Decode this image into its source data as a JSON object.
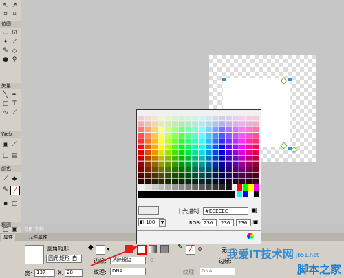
{
  "toolbar": {
    "section_bitmap": "位图",
    "section_vector": "矢量",
    "section_web": "Web",
    "section_colors": "颜色",
    "section_view": "视图",
    "icons": [
      "select-icon",
      "subselect-icon",
      "crop-icon",
      "marquee-icon",
      "lasso-icon",
      "magic-wand-icon",
      "brush-icon",
      "pencil-icon",
      "eraser-icon",
      "blur-icon",
      "line-icon",
      "pen-icon",
      "rectangle-icon",
      "text-icon",
      "freeform-icon",
      "knife-icon",
      "hotspot-icon",
      "slice-icon",
      "hide-slice-icon",
      "show-slice-icon",
      "eyedropper-icon",
      "paint-bucket-icon",
      "stroke-color-icon",
      "fill-color-icon",
      "swap-colors-icon",
      "standard-mode-icon",
      "full-screen-icon",
      "hand-icon",
      "zoom-icon"
    ]
  },
  "canvas": {
    "doc_label": "GIF 文档"
  },
  "color_popup": {
    "hex_label": "十六进制:",
    "hex_value": "#ECECEC",
    "rgb_label": "RGB:",
    "r": "236",
    "g": "236",
    "b": "236",
    "opacity": "100",
    "accent": "#ececec"
  },
  "panel": {
    "tab_properties": "属性",
    "tab_symbol": "元件属性",
    "shape_name": "圆角矩形",
    "shape_type": "圆角矩形",
    "shape_extra": "自",
    "edge_label": "边缘:",
    "edge_value": "消除锯齿",
    "texture_label": "纹理:",
    "texture_value": "DNA",
    "texture_label2": "纹理:",
    "texture_value2": "DNA",
    "stroke_none": "无",
    "edge_label2": "边缘:",
    "width_label": "宽:",
    "width_value": "137",
    "x_label": "X:",
    "x_value": "28",
    "zero": "0"
  },
  "watermark": {
    "text1": "我爱IT技术网",
    "text2": "脚本之家",
    "url": "jb51.net"
  }
}
